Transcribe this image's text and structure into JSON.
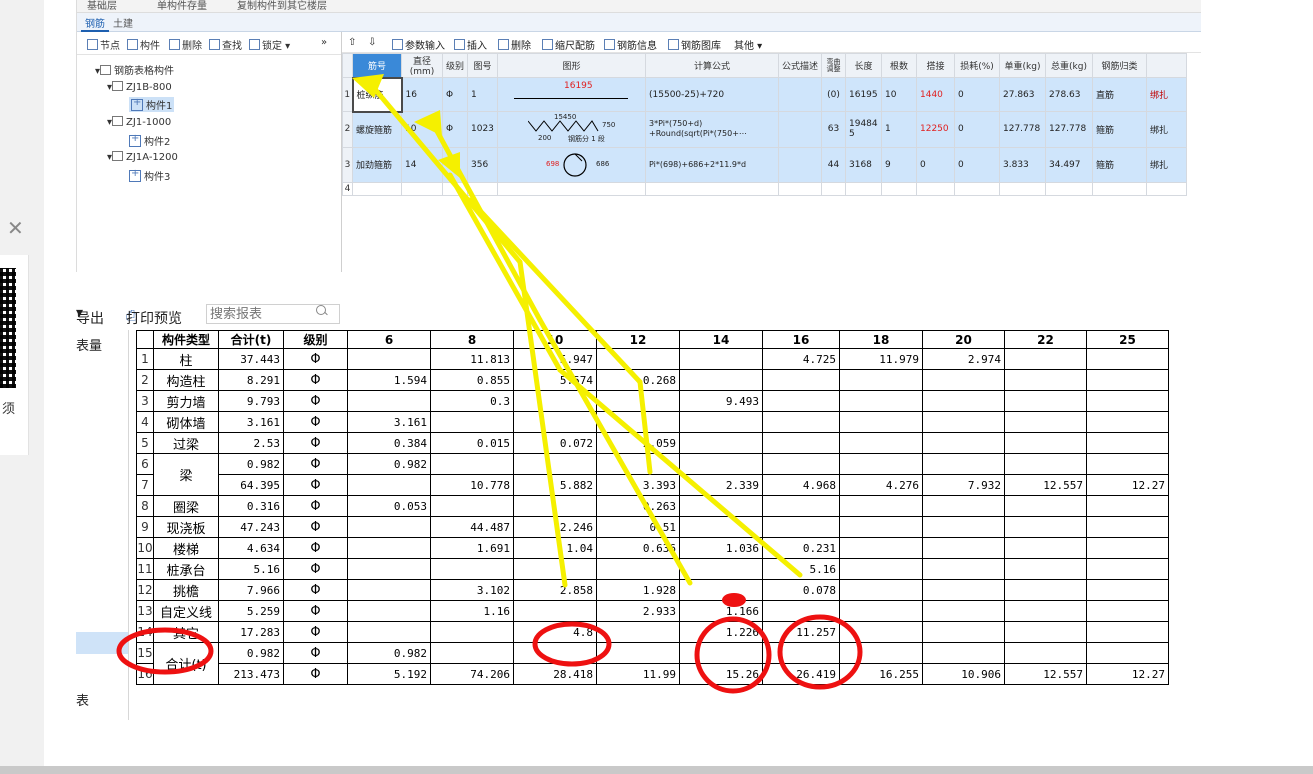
{
  "top_strip": {
    "dropdown": "基础层",
    "item1": "单构件存量",
    "item2": "复制构件到其它楼层"
  },
  "tabs": [
    "钢筋",
    "土建"
  ],
  "tree_toolbar": [
    "节点",
    "构件",
    "删除",
    "查找",
    "锁定"
  ],
  "tree": {
    "root": "钢筋表格构件",
    "groups": [
      {
        "name": "ZJ1B-800",
        "child": "构件1"
      },
      {
        "name": "ZJ1-1000",
        "child": "构件2"
      },
      {
        "name": "ZJ1A-1200",
        "child": "构件3"
      }
    ]
  },
  "rebar_toolbar": [
    "参数输入",
    "插入",
    "删除",
    "缩尺配筋",
    "钢筋信息",
    "钢筋图库",
    "其他"
  ],
  "rebar_headers": [
    "筋号",
    "直径(mm)",
    "级别",
    "图号",
    "图形",
    "计算公式",
    "公式描述",
    "弯曲调整",
    "长度",
    "根数",
    "搭接",
    "损耗(%)",
    "单重(kg)",
    "总重(kg)",
    "钢筋归类",
    ""
  ],
  "rebar_rows": [
    {
      "no": "1",
      "name": "桩纵筋",
      "dia": "16",
      "grade": "Φ",
      "fig": "1",
      "shape": "16195",
      "formula": "(15500-25)+720",
      "desc": "",
      "bend": "(0)",
      "len": "16195",
      "count": "10",
      "lap": "1440",
      "loss": "0",
      "unit": "27.863",
      "total": "278.63",
      "kind": "直筋",
      "tie": "绑扎"
    },
    {
      "no": "2",
      "name": "螺旋箍筋",
      "dia": "10",
      "grade": "Φ",
      "fig": "1023",
      "shape": "15450",
      "shape_h": "750",
      "shape_b": "200",
      "shape_note": "钢筋分 1 段",
      "formula": "3*Pi*(750+d)",
      "formula2": "+Round(sqrt(Pi*(750+⋯",
      "desc": "",
      "bend": "63",
      "len": "19484 5",
      "count": "1",
      "lap": "12250",
      "loss": "0",
      "unit": "127.778",
      "total": "127.778",
      "kind": "箍筋",
      "tie": "绑扎"
    },
    {
      "no": "3",
      "name": "加劲箍筋",
      "dia": "14",
      "grade": "Φ",
      "fig": "356",
      "shape": "698",
      "shape_r": "686",
      "formula": "Pi*(698)+686+2*11.9*d",
      "desc": "",
      "bend": "44",
      "len": "3168",
      "count": "9",
      "lap": "0",
      "loss": "0",
      "unit": "3.833",
      "total": "34.497",
      "kind": "箍筋",
      "tie": "绑扎"
    },
    {
      "no": "4"
    }
  ],
  "report_toolbar": {
    "export": "导出",
    "print": "打印预览",
    "search_placeholder": "搜索报表"
  },
  "left_list": {
    "top_item": "表量",
    "bottom_item": "表"
  },
  "side_text": "须",
  "report_headers": [
    "构件类型",
    "合计(t)",
    "级别",
    "6",
    "8",
    "10",
    "12",
    "14",
    "16",
    "18",
    "20",
    "22",
    "25"
  ],
  "report_rows": [
    {
      "no": "1",
      "type": "柱",
      "sum": "37.443",
      "grade": "Φ",
      "d6": "",
      "d8": "11.813",
      "d10": "5.947",
      "d12": "",
      "d14": "",
      "d16": "4.725",
      "d18": "11.979",
      "d20": "2.974",
      "d22": "",
      "d25": ""
    },
    {
      "no": "2",
      "type": "构造柱",
      "sum": "8.291",
      "grade": "Φ",
      "d6": "1.594",
      "d8": "0.855",
      "d10": "5.574",
      "d12": "0.268",
      "d14": "",
      "d16": "",
      "d18": "",
      "d20": "",
      "d22": "",
      "d25": ""
    },
    {
      "no": "3",
      "type": "剪力墙",
      "sum": "9.793",
      "grade": "Φ",
      "d6": "",
      "d8": "0.3",
      "d10": "",
      "d12": "",
      "d14": "9.493",
      "d16": "",
      "d18": "",
      "d20": "",
      "d22": "",
      "d25": ""
    },
    {
      "no": "4",
      "type": "砌体墙",
      "sum": "3.161",
      "grade": "Φ",
      "d6": "3.161",
      "d8": "",
      "d10": "",
      "d12": "",
      "d14": "",
      "d16": "",
      "d18": "",
      "d20": "",
      "d22": "",
      "d25": ""
    },
    {
      "no": "5",
      "type": "过梁",
      "sum": "2.53",
      "grade": "Φ",
      "d6": "0.384",
      "d8": "0.015",
      "d10": "0.072",
      "d12": "2.059",
      "d14": "",
      "d16": "",
      "d18": "",
      "d20": "",
      "d22": "",
      "d25": ""
    },
    {
      "no": "6",
      "type": "梁",
      "sum": "0.982",
      "grade": "Φ",
      "d6": "0.982",
      "d8": "",
      "d10": "",
      "d12": "",
      "d14": "",
      "d16": "",
      "d18": "",
      "d20": "",
      "d22": "",
      "d25": ""
    },
    {
      "no": "7",
      "type": "",
      "sum": "64.395",
      "grade": "Φ",
      "d6": "",
      "d8": "10.778",
      "d10": "5.882",
      "d12": "3.393",
      "d14": "2.339",
      "d16": "4.968",
      "d18": "4.276",
      "d20": "7.932",
      "d22": "12.557",
      "d25": "12.27"
    },
    {
      "no": "8",
      "type": "圈梁",
      "sum": "0.316",
      "grade": "Φ",
      "d6": "0.053",
      "d8": "",
      "d10": "",
      "d12": "0.263",
      "d14": "",
      "d16": "",
      "d18": "",
      "d20": "",
      "d22": "",
      "d25": ""
    },
    {
      "no": "9",
      "type": "现浇板",
      "sum": "47.243",
      "grade": "Φ",
      "d6": "",
      "d8": "44.487",
      "d10": "2.246",
      "d12": "0.51",
      "d14": "",
      "d16": "",
      "d18": "",
      "d20": "",
      "d22": "",
      "d25": ""
    },
    {
      "no": "10",
      "type": "楼梯",
      "sum": "4.634",
      "grade": "Φ",
      "d6": "",
      "d8": "1.691",
      "d10": "1.04",
      "d12": "0.636",
      "d14": "1.036",
      "d16": "0.231",
      "d18": "",
      "d20": "",
      "d22": "",
      "d25": ""
    },
    {
      "no": "11",
      "type": "桩承台",
      "sum": "5.16",
      "grade": "Φ",
      "d6": "",
      "d8": "",
      "d10": "",
      "d12": "",
      "d14": "",
      "d16": "5.16",
      "d18": "",
      "d20": "",
      "d22": "",
      "d25": ""
    },
    {
      "no": "12",
      "type": "挑檐",
      "sum": "7.966",
      "grade": "Φ",
      "d6": "",
      "d8": "3.102",
      "d10": "2.858",
      "d12": "1.928",
      "d14": "",
      "d16": "0.078",
      "d18": "",
      "d20": "",
      "d22": "",
      "d25": ""
    },
    {
      "no": "13",
      "type": "自定义线",
      "sum": "5.259",
      "grade": "Φ",
      "d6": "",
      "d8": "1.16",
      "d10": "",
      "d12": "2.933",
      "d14": "1.166",
      "d16": "",
      "d18": "",
      "d20": "",
      "d22": "",
      "d25": ""
    },
    {
      "no": "14",
      "type": "其它",
      "sum": "17.283",
      "grade": "Φ",
      "d6": "",
      "d8": "",
      "d10": "4.8",
      "d12": "",
      "d14": "1.226",
      "d16": "11.257",
      "d18": "",
      "d20": "",
      "d22": "",
      "d25": ""
    },
    {
      "no": "15",
      "type": "合计(t)",
      "sum": "0.982",
      "grade": "Φ",
      "d6": "0.982",
      "d8": "",
      "d10": "",
      "d12": "",
      "d14": "",
      "d16": "",
      "d18": "",
      "d20": "",
      "d22": "",
      "d25": ""
    },
    {
      "no": "16",
      "type": "",
      "sum": "213.473",
      "grade": "Φ",
      "d6": "5.192",
      "d8": "74.206",
      "d10": "28.418",
      "d12": "11.99",
      "d14": "15.26",
      "d16": "26.419",
      "d18": "16.255",
      "d20": "10.906",
      "d22": "12.557",
      "d25": "12.27"
    }
  ],
  "annotation_colors": {
    "arrow": "#f5f000",
    "circle": "#ee1111"
  }
}
